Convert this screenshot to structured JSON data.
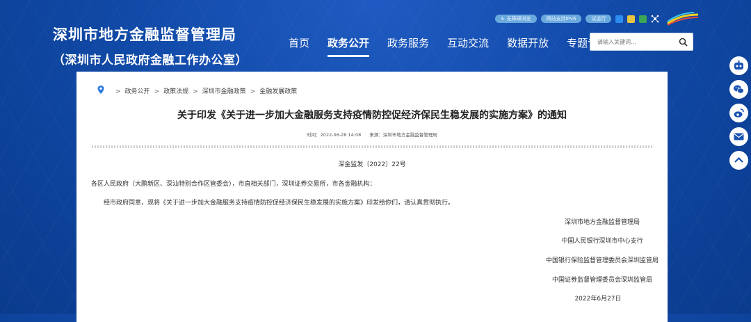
{
  "site": {
    "title": "深圳市地方金融监督管理局",
    "subtitle": "（深圳市人民政府金融工作办公室）"
  },
  "utility": {
    "accessibility": "无障碍浏览",
    "ipv6": "网站支持IPv6",
    "trial": "试运行"
  },
  "nav": [
    "首页",
    "政务公开",
    "政务服务",
    "互动交流",
    "数据开放",
    "专题专栏"
  ],
  "nav_active": "政务公开",
  "search": {
    "placeholder": "请输入关键词..."
  },
  "breadcrumb": [
    "政务公开",
    "政策法规",
    "深圳市金融政策",
    "金融发展政策"
  ],
  "doc": {
    "title": "关于印发《关于进一步加大金融服务支持疫情防控促经济保民生稳发展的实施方案》的通知",
    "time": "时间：2022-06-28 14:08",
    "source": "来源：深圳市地方金融监督管理局",
    "number": "深金监发〔2022〕22号",
    "addressee": "各区人民政府（大鹏新区、深汕特别合作区管委会），市直相关部门，深圳证券交易所，市各金融机构：",
    "body": "经市政府同意，现将《关于进一步加大金融服务支持疫情防控促经济保民生稳发展的实施方案》印发给你们，请认真贯彻执行。",
    "signatories": [
      "深圳市地方金融监督管理局",
      "中国人民银行深圳市中心支行",
      "中国银行保险监督管理委员会深圳监管局",
      "中国证券监督管理委员会深圳监管局"
    ],
    "date": "2022年6月27日"
  },
  "colors": {
    "header_bg": "#114aa8",
    "pill": "#6aa9de",
    "side_icon": "#1a52b3"
  },
  "side_icons": [
    "robot-icon",
    "wechat-icon",
    "weibo-icon",
    "mail-icon",
    "back-to-top-icon"
  ]
}
